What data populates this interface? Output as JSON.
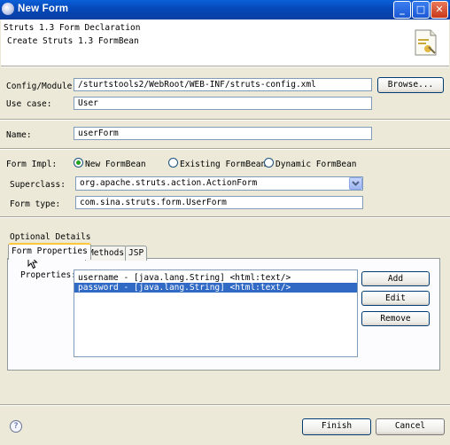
{
  "window": {
    "title": "New Form"
  },
  "header": {
    "title": "Struts 1.3 Form Declaration",
    "description": "Create Struts 1.3 FormBean"
  },
  "config": {
    "label": "Config/Module:",
    "value": "/sturtstools2/WebRoot/WEB-INF/struts-config.xml",
    "browse_label": "Browse..."
  },
  "use_case": {
    "label": "Use case:",
    "value": "User"
  },
  "name": {
    "label": "Name:",
    "value": "userForm"
  },
  "form_impl": {
    "label": "Form Impl:",
    "options": [
      "New FormBean",
      "Existing FormBean",
      "Dynamic FormBean"
    ],
    "selected": "New FormBean"
  },
  "superclass": {
    "label": "Superclass:",
    "value": "org.apache.struts.action.ActionForm"
  },
  "form_type": {
    "label": "Form type:",
    "value": "com.sina.struts.form.UserForm"
  },
  "optional": {
    "label": "Optional Details",
    "tabs": [
      "Form Properties",
      "Methods",
      "JSP"
    ],
    "active_tab": "Form Properties",
    "properties_label": "Properties:",
    "properties": [
      "username - [java.lang.String] <html:text/>",
      "password - [java.lang.String] <html:text/>"
    ],
    "selected_property": 1,
    "buttons": {
      "add": "Add",
      "edit": "Edit",
      "remove": "Remove"
    }
  },
  "footer": {
    "finish": "Finish",
    "cancel": "Cancel",
    "help_glyph": "?"
  },
  "icons": [
    "app-icon",
    "minimize-icon",
    "maximize-icon",
    "close-icon",
    "wizard-banner-icon",
    "help-icon",
    "chevron-down-icon",
    "mouse-cursor-icon"
  ],
  "colors": {
    "titlebar": "#0548b8",
    "selection": "#316ac5",
    "dialog_bg": "#ece9d8"
  }
}
